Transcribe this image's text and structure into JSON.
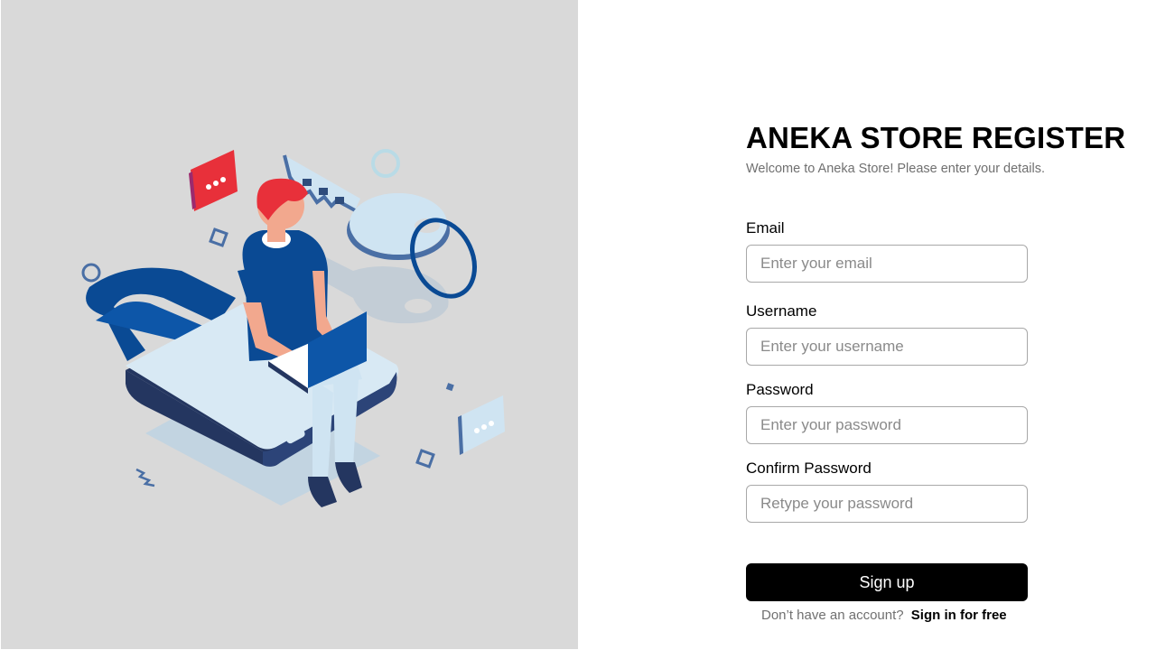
{
  "register": {
    "title": "ANEKA STORE REGISTER",
    "subtitle": "Welcome to Aneka Store! Please enter your details."
  },
  "form": {
    "email": {
      "label": "Email",
      "placeholder": "Enter your email",
      "value": ""
    },
    "username": {
      "label": "Username",
      "placeholder": "Enter your username",
      "value": ""
    },
    "password": {
      "label": "Password",
      "placeholder": "Enter your password",
      "value": ""
    },
    "confirm_password": {
      "label": "Confirm Password",
      "placeholder": "Retype your password",
      "value": ""
    },
    "submit_label": "Sign up"
  },
  "footer": {
    "prompt": "Don’t have an account?",
    "link_label": "Sign in for free"
  },
  "colors": {
    "panel_background": "#d9d9d9",
    "accent_blue": "#0a4a94",
    "accent_red": "#e8303a",
    "light_blue": "#cfe4f2",
    "button_background": "#000000"
  },
  "icons": {
    "illustration": "person-with-laptop-on-padlock-with-key",
    "chat_bubble": "chat-bubble-icon",
    "key": "key-icon",
    "padlock": "padlock-icon"
  }
}
